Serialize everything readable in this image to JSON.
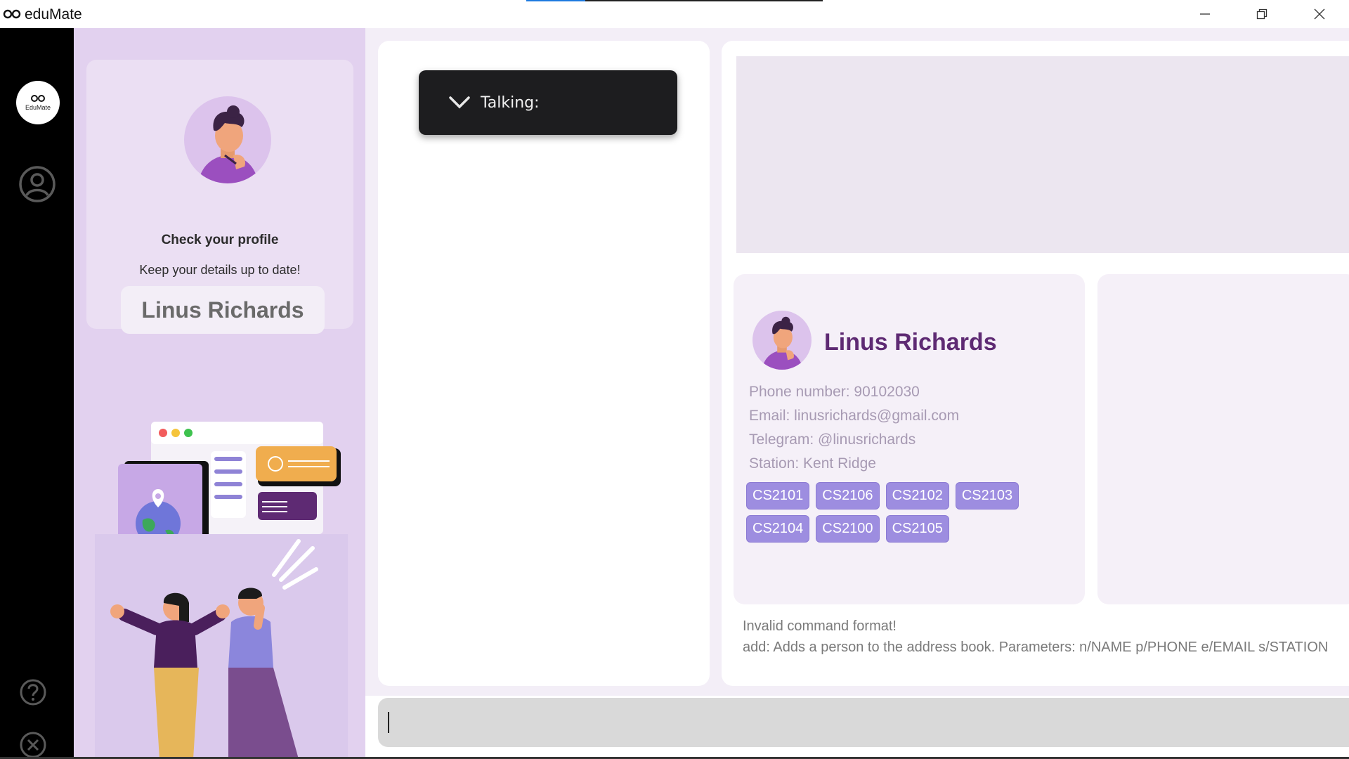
{
  "window": {
    "title": "eduMate",
    "load_progress": 0.2,
    "controls": [
      "minimize-icon",
      "restore-icon",
      "close-icon"
    ]
  },
  "rail": {
    "logo_text": "EduMate",
    "icons": [
      "profile-icon",
      "help-icon",
      "exit-icon"
    ]
  },
  "sidebar": {
    "check_title": "Check your profile",
    "check_subtitle": "Keep your details up to date!",
    "user_name": "Linus Richards"
  },
  "talking": {
    "label": "Talking:",
    "icon": "chevron-down-icon"
  },
  "person": {
    "name": "Linus Richards",
    "phone": "Phone number: 90102030",
    "email": "Email: linusrichards@gmail.com",
    "telegram": "Telegram: @linusrichards",
    "station": "Station: Kent Ridge",
    "tags": [
      "CS2101",
      "CS2106",
      "CS2102",
      "CS2103",
      "CS2104",
      "CS2100",
      "CS2105"
    ]
  },
  "result": {
    "line1": "Invalid command format!",
    "line2": "add: Adds a person to the address book. Parameters: n/NAME p/PHONE e/EMAIL s/STATION"
  },
  "command": {
    "value": ""
  },
  "colors": {
    "accent_purple": "#5e2a73",
    "tag_purple": "#9d8de0",
    "sidebar_lilac": "#e2d1ef"
  }
}
